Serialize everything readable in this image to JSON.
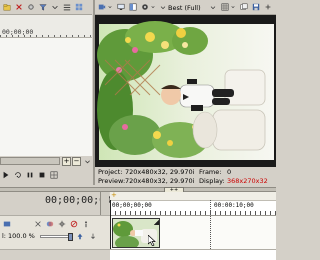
{
  "left_panel": {
    "timecode": "00;00;00"
  },
  "preview": {
    "quality_label": "Best (Full)",
    "info": {
      "project_label": "Project:",
      "project_value": "720x480x32, 29.970i",
      "preview_label": "Preview:",
      "preview_value": "720x480x32, 29.970i",
      "frame_label": "Frame:",
      "frame_value": "0",
      "display_label": "Display:",
      "display_value": "368x270x32"
    }
  },
  "timeline": {
    "timecode": "00;00;00;00",
    "ruler_start": "00;00;00;00",
    "ruler_mid": "00:00:10;00",
    "level_label": "l:",
    "level_value": "100.0 %",
    "marker_label": "+",
    "playhead_label": "++"
  },
  "colors": {
    "accent_red": "#cc0000",
    "panel_bg": "#d4d0c8"
  },
  "icons": [
    "folder-icon",
    "gear-icon",
    "filter-icon",
    "monitor-icon",
    "split-screen-icon",
    "play-icon",
    "loop-icon",
    "pause-icon",
    "stop-icon",
    "zoom-in-icon",
    "zoom-out-icon",
    "snap-icon",
    "lock-icon",
    "mute-icon",
    "solo-icon",
    "cursor-icon"
  ]
}
